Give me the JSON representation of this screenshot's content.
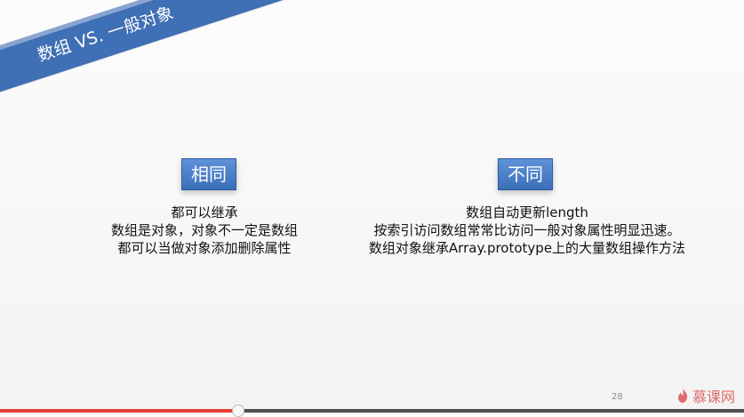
{
  "slide": {
    "title": "数组 VS. 一般对象",
    "left_heading": "相同",
    "left_lines": [
      "都可以继承",
      "数组是对象，对象不一定是数组",
      "都可以当做对象添加删除属性"
    ],
    "right_heading": "不同",
    "right_lines": [
      "数组自动更新length",
      "按索引访问数组常常比访问一般对象属性明显迅速。",
      "数组对象继承Array.prototype上的大量数组操作方法"
    ],
    "page_number": "28"
  },
  "brand": {
    "label": "慕课网",
    "icon": "flame-icon",
    "color": "#df6b6b"
  },
  "player": {
    "progress": 0.32
  },
  "colors": {
    "accent": "#3f6fb4",
    "progress": "#e53f36"
  }
}
